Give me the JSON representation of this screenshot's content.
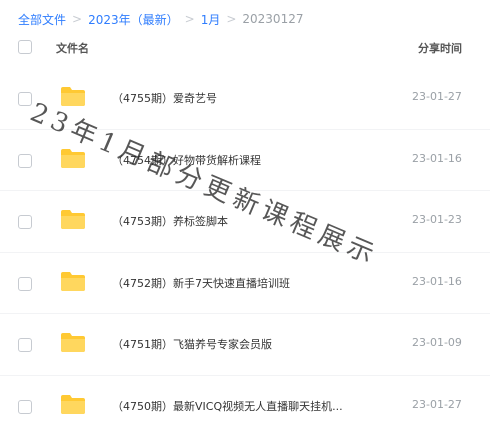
{
  "breadcrumb": {
    "items": [
      "全部文件",
      "2023年（最新）",
      "1月"
    ],
    "current": "20230127"
  },
  "header": {
    "name_label": "文件名",
    "date_label": "分享时间"
  },
  "rows": [
    {
      "name": "（4755期）爱奇艺号",
      "date": "23-01-27"
    },
    {
      "name": "（4754期）好物带货解析课程",
      "date": "23-01-16"
    },
    {
      "name": "（4753期）养标签脚本",
      "date": "23-01-23"
    },
    {
      "name": "（4752期）新手7天快速直播培训班",
      "date": "23-01-16"
    },
    {
      "name": "（4751期）飞猫养号专家会员版",
      "date": "23-01-09"
    },
    {
      "name": "（4750期）最新VICQ视频无人直播聊天挂机...",
      "date": "23-01-27"
    }
  ],
  "watermark": "23年1月部分更新课程展示",
  "colors": {
    "link": "#2f7dfe",
    "folder": "#ffc933",
    "muted": "#9aa0a6"
  },
  "icons": {
    "folder": "folder-icon",
    "chevron": "chevron-right-icon"
  }
}
